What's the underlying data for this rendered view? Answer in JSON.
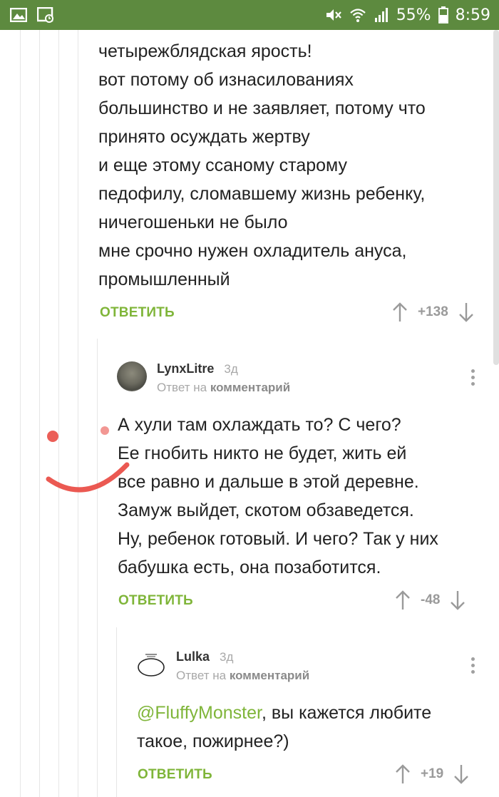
{
  "status_bar": {
    "battery": "55%",
    "time": "8:59"
  },
  "comments": [
    {
      "lines": [
        "четырежблядская ярость!",
        "вот потому об изнасилованиях",
        "большинство и не заявляет, потому что",
        "принято осуждать жертву",
        "и еще этому ссаному старому",
        "педофилу, сломавшему жизнь ребенку,",
        "ничегошеньки не было",
        "мне срочно нужен охладитель ануса,",
        "промышленный"
      ],
      "reply_label": "ОТВЕТИТЬ",
      "score": "+138"
    },
    {
      "username": "LynxLitre",
      "time": "3д",
      "reply_to_prefix": "Ответ на",
      "reply_to_target": "комментарий",
      "lines": [
        "А хули там охлаждать то? С чего?",
        "Ее гнобить никто не будет, жить ей",
        "все равно и дальше в этой деревне.",
        "Замуж выйдет, скотом обзаведется.",
        "Ну, ребенок готовый. И чего? Так у них",
        "бабушка есть, она позаботится."
      ],
      "reply_label": "ОТВЕТИТЬ",
      "score": "-48"
    },
    {
      "username": "Lulka",
      "time": "3д",
      "reply_to_prefix": "Ответ на",
      "reply_to_target": "комментарий",
      "mention": "@FluffyMonster",
      "line1_rest": ", вы кажется любите",
      "line2": "такое, пожирнее?)",
      "reply_label": "ОТВЕТИТЬ",
      "score": "+19"
    }
  ],
  "colors": {
    "status_bar": "#5d8a3f",
    "accent_green": "#7fb539",
    "drawn_smile": "#e8423a"
  },
  "icons": [
    "image-icon",
    "gallery-icon",
    "mute-icon",
    "wifi-icon",
    "signal-icon",
    "battery-icon",
    "upvote-arrow-icon",
    "downvote-arrow-icon",
    "more-options-icon"
  ]
}
